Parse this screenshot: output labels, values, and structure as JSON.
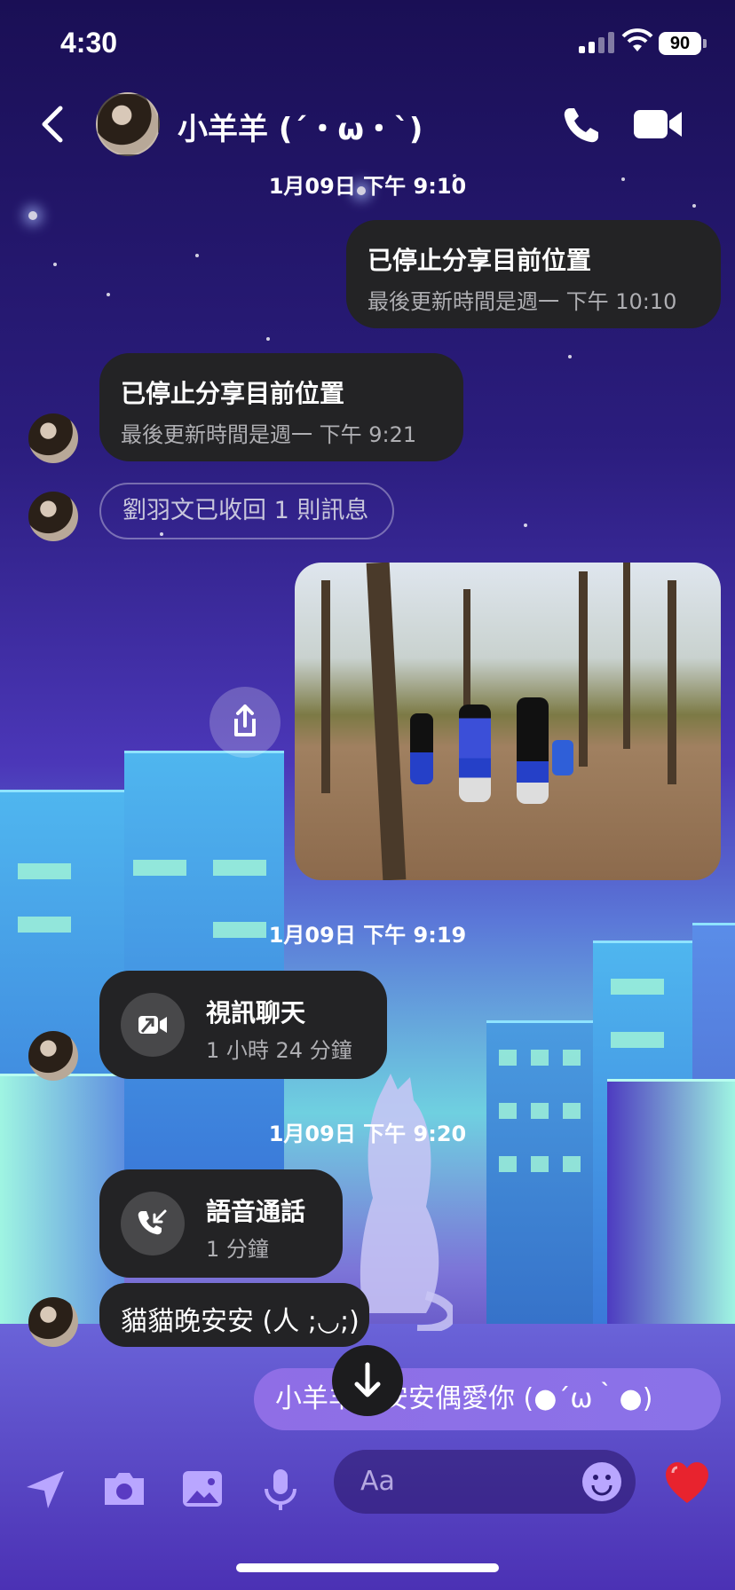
{
  "status_bar": {
    "time": "4:30",
    "battery": "90"
  },
  "header": {
    "contact_name": "小羊羊 (´・ω・`)"
  },
  "timestamps": [
    "1月09日 下午 9:10",
    "1月09日 下午 9:19",
    "1月09日 下午 9:20"
  ],
  "messages": {
    "location_sent": {
      "title": "已停止分享目前位置",
      "subtitle": "最後更新時間是週一 下午 10:10"
    },
    "location_received": {
      "title": "已停止分享目前位置",
      "subtitle": "最後更新時間是週一 下午 9:21"
    },
    "unsent_notice": "劉羽文已收回 1 則訊息",
    "video_call": {
      "title": "視訊聊天",
      "duration": "1 小時 24 分鐘"
    },
    "voice_call": {
      "title": "語音通話",
      "duration": "1 分鐘"
    },
    "received_text": "貓貓晚安安 (人 ;◡;)",
    "sent_text": "小羊羊晚安安偶愛你 (●´ω｀●)"
  },
  "composer": {
    "placeholder": "Aa"
  },
  "icons": [
    "back-icon",
    "phone-icon",
    "video-camera-icon",
    "share-icon",
    "arrow-down-icon",
    "location-arrow-icon",
    "camera-icon",
    "image-icon",
    "microphone-icon",
    "emoji-icon",
    "heart-icon"
  ]
}
